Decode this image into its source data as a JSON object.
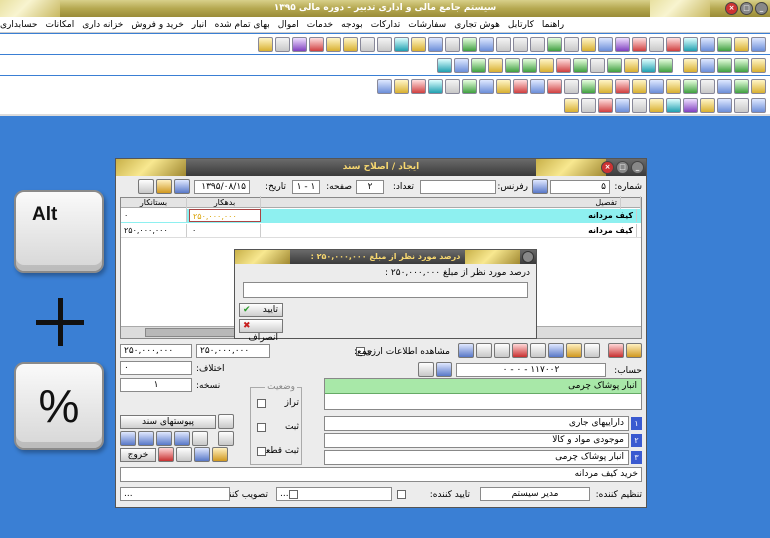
{
  "app": {
    "title": "سیستم جامع مالی و اداری تدبیر - دوره مالی ۱۳۹۵"
  },
  "menu": [
    "حسابداری",
    "امکانات",
    "خزانه داری",
    "خرید و فروش",
    "انبار",
    "بهای تمام شده",
    "اموال",
    "خدمات",
    "بودجه",
    "تدارکات",
    "سفارشات",
    "هوش تجاری",
    "کارتابل",
    "راهنما"
  ],
  "keys": {
    "alt": "Alt",
    "percent": "%"
  },
  "voucher": {
    "title": "ایجاد / اصلاح سند",
    "number_label": "شماره:",
    "number_value": "۵",
    "reference_label": "رفرنس:",
    "count_label": "تعداد:",
    "count_value": "۲",
    "page_label": "صفحه:",
    "page_value": "۱ - ۱",
    "date_label": "تاریخ:",
    "date_value": "۱۳۹۵/۰۸/۱۵",
    "grid": {
      "headers": {
        "account": "تفصیل",
        "debit": "بدهکار",
        "credit": "بستانکار"
      },
      "rows": [
        {
          "account": "کیف مردانه",
          "debit": "۲۵۰,۰۰۰,۰۰۰",
          "credit": "۰"
        },
        {
          "account": "کیف مردانه",
          "debit": "۰",
          "credit": "۲۵۰,۰۰۰,۰۰۰"
        }
      ]
    },
    "currency_info_label": "مشاهده اطلاعات ارزی",
    "sum_label": "جمع:",
    "sum_debit": "۲۵۰,۰۰۰,۰۰۰",
    "sum_credit": "۲۵۰,۰۰۰,۰۰۰",
    "diff_label": "اختلاف:",
    "diff_value": "۰",
    "copies_label": "نسخه:",
    "copies_value": "۱",
    "account_label": "حساب:",
    "account_code": "۱۱۷۰۰۲ - ۰ - ۰",
    "account_selected": "انبار پوشاک چرمی",
    "status_title": "وضعیت",
    "status_balance": "تراز",
    "status_fixed": "ثبت",
    "status_final": "ثبت قطعی",
    "attachments_label": "پیوستهای سند",
    "exit_label": "خروج",
    "accounts": [
      {
        "num": "۱",
        "name": "داراییهای جاری"
      },
      {
        "num": "۲",
        "name": "موجودی مواد و کالا"
      },
      {
        "num": "۳",
        "name": "انبار پوشاک چرمی"
      }
    ],
    "description": "خرید کیف مردانه",
    "prepared_by_label": "تنظیم کننده:",
    "prepared_by_value": "مدیر سیستم",
    "approved_by_label": "تایید کننده:",
    "approved_by_value": "...",
    "ratified_by_label": "تصویب کننده:",
    "ratified_by_value": "..."
  },
  "dialog": {
    "title": "درصد مورد نظر از مبلغ ۲۵۰,۰۰۰,۰۰۰ :",
    "prompt": "درصد مورد نظر از مبلغ ۲۵۰,۰۰۰,۰۰۰ :",
    "input_value": "",
    "ok_label": "تایید",
    "cancel_label": "انصراف"
  }
}
